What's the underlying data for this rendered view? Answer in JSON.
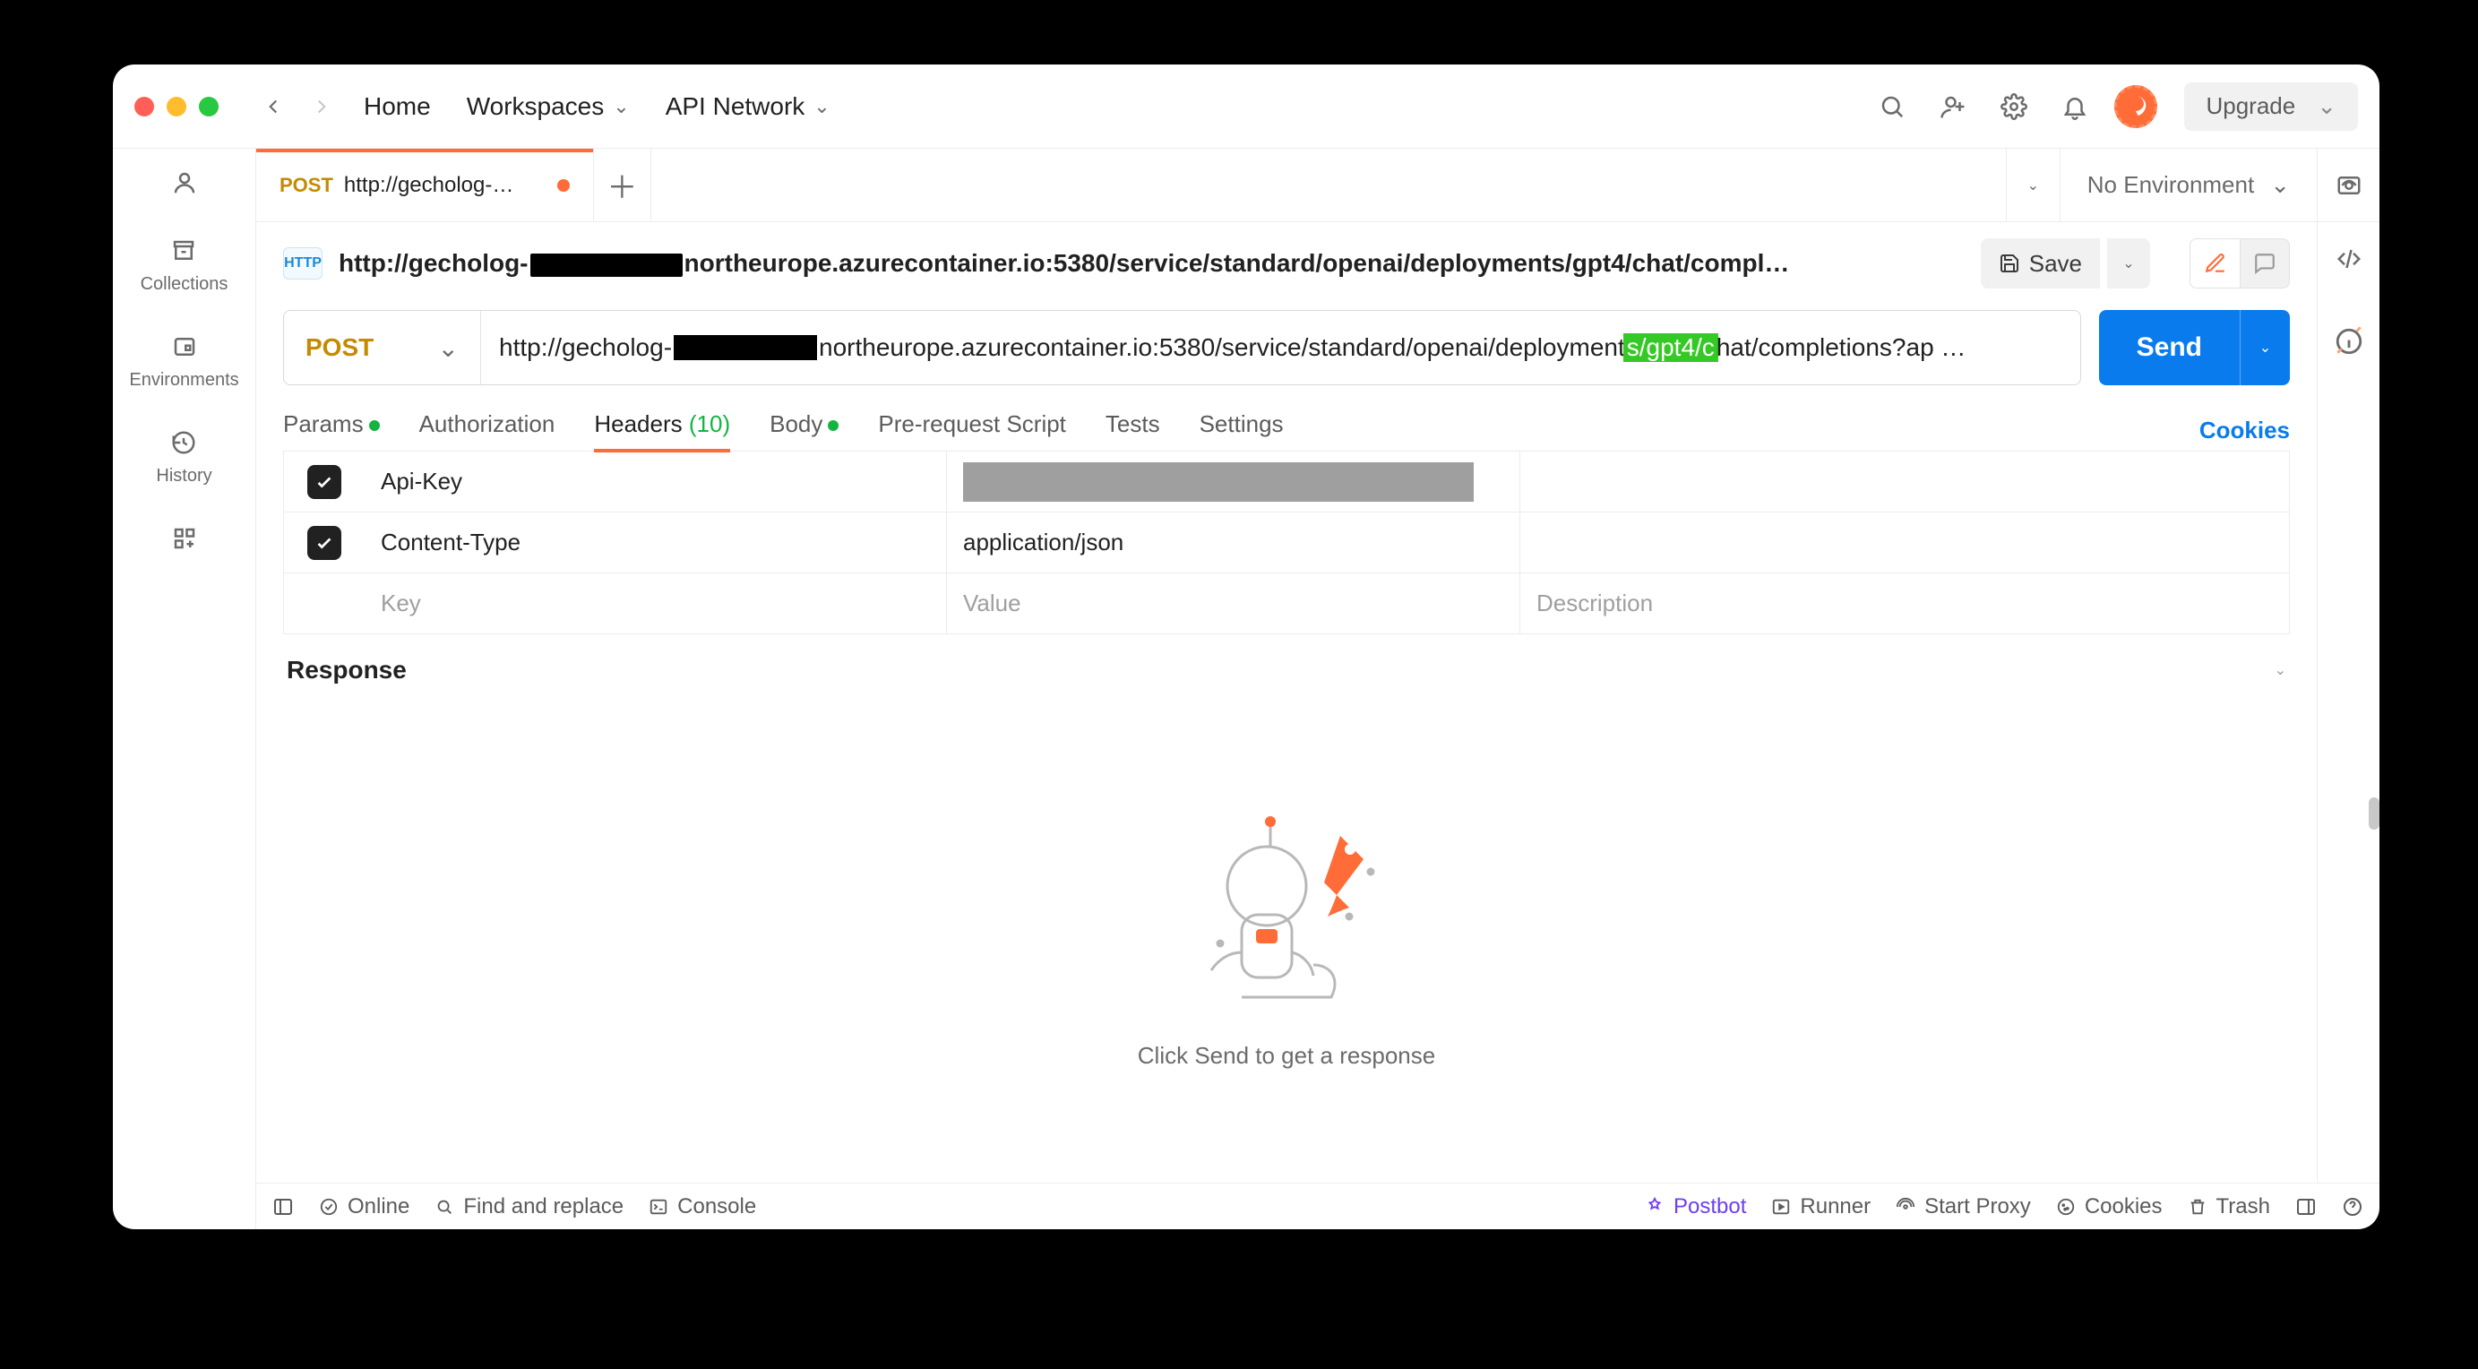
{
  "window": {
    "title": "Postman"
  },
  "titlebar": {
    "home": "Home",
    "workspaces": "Workspaces",
    "apinetwork": "API Network",
    "upgrade": "Upgrade"
  },
  "rail": {
    "collections": "Collections",
    "environments": "Environments",
    "history": "History"
  },
  "tabs": {
    "active": {
      "method": "POST",
      "title_prefix": "http://gecholog-"
    }
  },
  "env": {
    "selected": "No Environment"
  },
  "request": {
    "badge": "HTTP",
    "url_display_prefix": "http://gecholog-",
    "url_display_suffix": "northeurope.azurecontainer.io:5380/service/standard/openai/deployments/gpt4/chat/compl…",
    "save_label": "Save",
    "method": "POST",
    "url_prefix": "http://gecholog-",
    "url_mid": "northeurope.azurecontainer.io:5380/service/standard/openai/deployment",
    "url_hl": "s/gpt4/c",
    "url_tail": "hat/completions?ap …",
    "send_label": "Send"
  },
  "subtabs": {
    "params": "Params",
    "auth": "Authorization",
    "headers": "Headers",
    "headers_count": "(10)",
    "body": "Body",
    "prereq": "Pre-request Script",
    "tests": "Tests",
    "settings": "Settings",
    "cookies": "Cookies"
  },
  "headers_table": {
    "rows": [
      {
        "key": "Api-Key",
        "value_masked": true
      },
      {
        "key": "Content-Type",
        "value": "application/json"
      }
    ],
    "placeholders": {
      "key": "Key",
      "value": "Value",
      "description": "Description"
    }
  },
  "response": {
    "title": "Response",
    "empty_msg": "Click Send to get a response"
  },
  "bottom": {
    "online": "Online",
    "find": "Find and replace",
    "console": "Console",
    "postbot": "Postbot",
    "runner": "Runner",
    "startproxy": "Start Proxy",
    "cookies": "Cookies",
    "trash": "Trash"
  }
}
